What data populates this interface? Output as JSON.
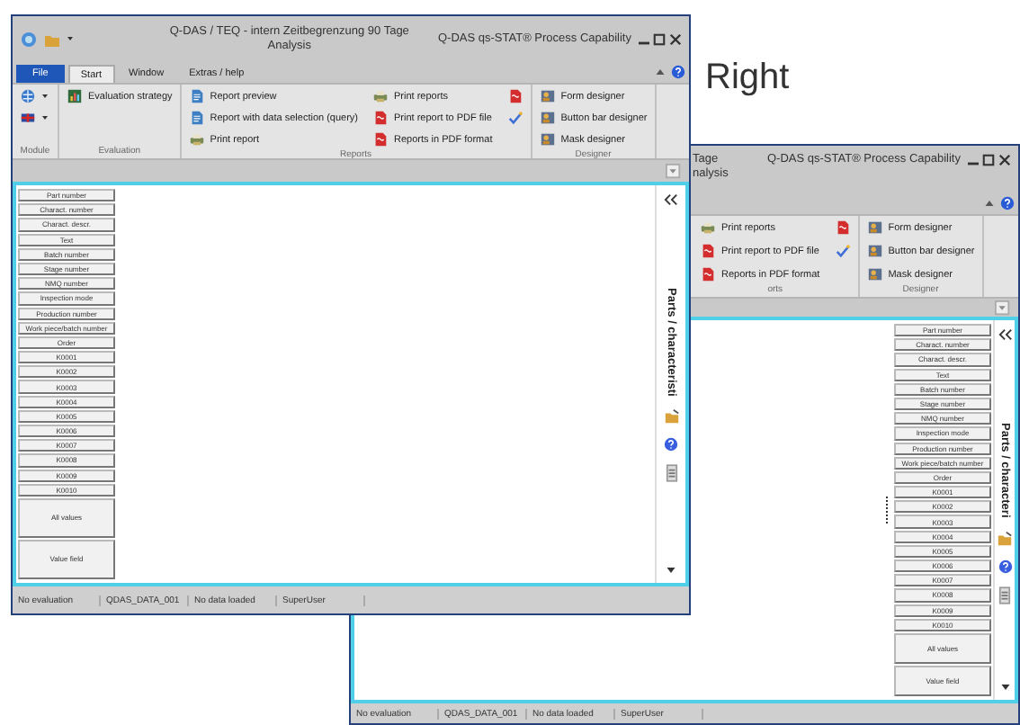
{
  "caption": "Right",
  "windows": [
    {
      "kind": "full",
      "title_lines": [
        "Q-DAS / TEQ - intern Zeitbegrenzung 90 Tage",
        "Analysis"
      ],
      "app_title": "Q-DAS qs-STAT® Process Capability",
      "tabs": [
        {
          "label": "File",
          "kind": "file",
          "selected": false
        },
        {
          "label": "Start",
          "kind": "tab",
          "selected": true
        },
        {
          "label": "Window",
          "kind": "tab",
          "selected": false
        },
        {
          "label": "Extras / help",
          "kind": "tab",
          "selected": false
        }
      ],
      "ribbon": [
        {
          "label": "Module",
          "columns": [
            [
              {
                "kind": "module"
              },
              {
                "kind": "language"
              }
            ]
          ]
        },
        {
          "label": "Evaluation",
          "columns": [
            [
              {
                "kind": "strategy",
                "label": "Evaluation strategy"
              }
            ]
          ]
        },
        {
          "label": "Reports",
          "columns": [
            [
              {
                "kind": "preview",
                "label": "Report preview"
              },
              {
                "kind": "preview",
                "label": "Report with data selection (query)"
              },
              {
                "kind": "print",
                "label": "Print report"
              }
            ],
            [
              {
                "kind": "print",
                "label": "Print reports"
              },
              {
                "kind": "pdf",
                "label": "Print report to PDF file"
              },
              {
                "kind": "pdf",
                "label": "Reports in PDF format"
              }
            ],
            [
              {
                "kind": "pdf"
              },
              {
                "kind": "check"
              }
            ]
          ]
        },
        {
          "label": "Designer",
          "columns": [
            [
              {
                "kind": "designer",
                "label": "Form designer"
              },
              {
                "kind": "designer",
                "label": "Button bar designer"
              },
              {
                "kind": "designer",
                "label": "Mask designer"
              }
            ]
          ]
        }
      ],
      "buttons": [
        {
          "kind": "field",
          "label": "Part number"
        },
        {
          "kind": "field",
          "label": "Charact. number"
        },
        {
          "kind": "field",
          "label": "Charact. descr."
        },
        {
          "kind": "field",
          "label": "Text"
        },
        {
          "kind": "field",
          "label": "Batch number"
        },
        {
          "kind": "field",
          "label": "Stage number"
        },
        {
          "kind": "field",
          "label": "NMQ number"
        },
        {
          "kind": "field",
          "label": "Inspection mode"
        },
        {
          "kind": "field",
          "label": "Production number"
        },
        {
          "kind": "field",
          "label": "Work piece/batch number"
        },
        {
          "kind": "field",
          "label": "Order"
        },
        {
          "kind": "field",
          "label": "K0001"
        },
        {
          "kind": "field",
          "label": "K0002"
        },
        {
          "kind": "field",
          "label": "K0003"
        },
        {
          "kind": "field",
          "label": "K0004"
        },
        {
          "kind": "field",
          "label": "K0005"
        },
        {
          "kind": "field",
          "label": "K0006"
        },
        {
          "kind": "field",
          "label": "K0007"
        },
        {
          "kind": "field",
          "label": "K0008"
        },
        {
          "kind": "field",
          "label": "K0009"
        },
        {
          "kind": "field",
          "label": "K0010"
        },
        {
          "kind": "action",
          "label": "All values"
        },
        {
          "kind": "action",
          "label": "Value field"
        }
      ],
      "side_label": "Parts / characteristi",
      "status": [
        "No evaluation",
        "QDAS_DATA_001",
        "No data loaded",
        "SuperUser"
      ]
    },
    {
      "kind": "partial",
      "title_lines": [
        "Tage",
        "nalysis"
      ],
      "app_title": "Q-DAS qs-STAT® Process Capability",
      "ribbon": [
        {
          "label": "orts",
          "columns": [
            [
              {
                "kind": "print",
                "label": "Print reports"
              },
              {
                "kind": "pdf",
                "label": "Print report to PDF file"
              },
              {
                "kind": "pdf",
                "label": "Reports in PDF format"
              }
            ],
            [
              {
                "kind": "pdf"
              },
              {
                "kind": "check"
              }
            ]
          ]
        },
        {
          "label": "Designer",
          "columns": [
            [
              {
                "kind": "designer",
                "label": "Form designer"
              },
              {
                "kind": "designer",
                "label": "Button bar designer"
              },
              {
                "kind": "designer",
                "label": "Mask designer"
              }
            ]
          ]
        }
      ],
      "buttons": [
        {
          "kind": "field",
          "label": "Part number"
        },
        {
          "kind": "field",
          "label": "Charact. number"
        },
        {
          "kind": "field",
          "label": "Charact. descr."
        },
        {
          "kind": "field",
          "label": "Text"
        },
        {
          "kind": "field",
          "label": "Batch number"
        },
        {
          "kind": "field",
          "label": "Stage number"
        },
        {
          "kind": "field",
          "label": "NMQ number"
        },
        {
          "kind": "field",
          "label": "Inspection mode"
        },
        {
          "kind": "field",
          "label": "Production number"
        },
        {
          "kind": "field",
          "label": "Work piece/batch number"
        },
        {
          "kind": "field",
          "label": "Order"
        },
        {
          "kind": "field",
          "label": "K0001"
        },
        {
          "kind": "field",
          "label": "K0002"
        },
        {
          "kind": "field",
          "label": "K0003"
        },
        {
          "kind": "field",
          "label": "K0004"
        },
        {
          "kind": "field",
          "label": "K0005"
        },
        {
          "kind": "field",
          "label": "K0006"
        },
        {
          "kind": "field",
          "label": "K0007"
        },
        {
          "kind": "field",
          "label": "K0008"
        },
        {
          "kind": "field",
          "label": "K0009"
        },
        {
          "kind": "field",
          "label": "K0010"
        },
        {
          "kind": "action",
          "label": "All values"
        },
        {
          "kind": "action",
          "label": "Value field"
        }
      ],
      "side_label": "Parts / characteri",
      "status": [
        "No evaluation",
        "QDAS_DATA_001",
        "No data loaded",
        "SuperUser"
      ]
    }
  ]
}
